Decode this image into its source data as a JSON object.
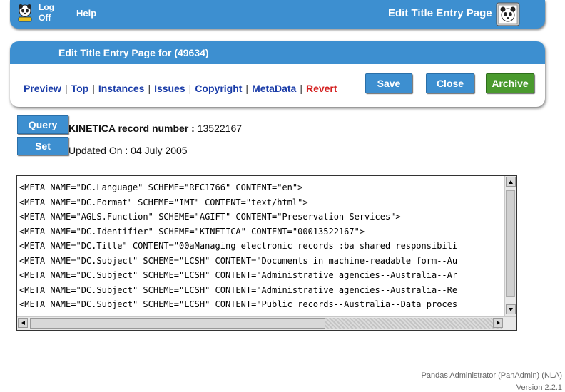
{
  "topbar": {
    "logoff_line1": "Log",
    "logoff_line2": "Off",
    "help_label": "Help",
    "page_title": "Edit Title Entry Page"
  },
  "panel": {
    "header": "Edit Title Entry Page for (49634)",
    "nav": [
      "Preview",
      "Top",
      "Instances",
      "Issues",
      "Copyright",
      "MetaData",
      "Revert"
    ],
    "separator": "|",
    "save_label": "Save",
    "close_label": "Close",
    "archive_label": "Archive"
  },
  "record": {
    "query_label": "Query",
    "set_label": "Set",
    "record_label": "KINETICA record number :",
    "record_number": "13522167",
    "updated_text": "Updated On : 04 July 2005"
  },
  "metadata": {
    "text": "<META NAME=\"DC.Language\" SCHEME=\"RFC1766\" CONTENT=\"en\">\n<META NAME=\"DC.Format\" SCHEME=\"IMT\" CONTENT=\"text/html\">\n<META NAME=\"AGLS.Function\" SCHEME=\"AGIFT\" CONTENT=\"Preservation Services\">\n<META NAME=\"DC.Identifier\" SCHEME=\"KINETICA\" CONTENT=\"00013522167\">\n<META NAME=\"DC.Title\" CONTENT=\"00aManaging electronic records :ba shared responsibili\n<META NAME=\"DC.Subject\" SCHEME=\"LCSH\" CONTENT=\"Documents in machine-readable form--Au\n<META NAME=\"DC.Subject\" SCHEME=\"LCSH\" CONTENT=\"Administrative agencies--Australia--Ar\n<META NAME=\"DC.Subject\" SCHEME=\"LCSH\" CONTENT=\"Administrative agencies--Australia--Re\n<META NAME=\"DC.Subject\" SCHEME=\"LCSH\" CONTENT=\"Public records--Australia--Data proces"
  },
  "footer": {
    "line1": "Pandas Administrator (PanAdmin) (NLA)",
    "line2": "Version 2.2.1"
  },
  "colors": {
    "accent": "#3d8fd0",
    "archive": "#4a9a2e",
    "revert": "#d42020",
    "link": "#1a3ca8"
  },
  "icons": {
    "small_logo": "panda-icon",
    "big_logo": "panda-monitor-icon"
  }
}
